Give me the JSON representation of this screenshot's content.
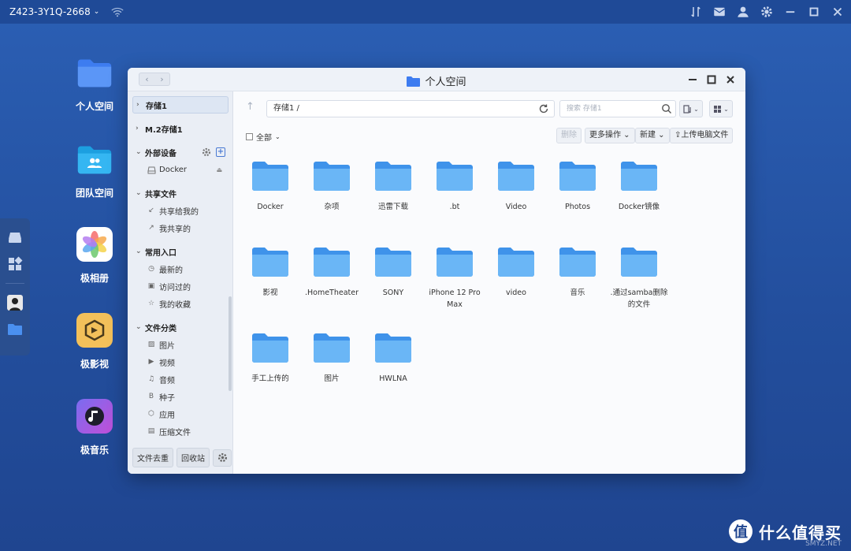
{
  "topbar": {
    "device_name": "Z423-3Y1Q-2668",
    "icons": [
      "sort-icon",
      "mail-icon",
      "user-icon",
      "gear-icon",
      "minimize-icon",
      "maximize-icon",
      "close-icon"
    ]
  },
  "desktop": {
    "icons": [
      {
        "label": "个人空间",
        "icon": "folder-icon"
      },
      {
        "label": "团队空间",
        "icon": "team-folder-icon"
      },
      {
        "label": "极相册",
        "icon": "photos-icon"
      },
      {
        "label": "极影视",
        "icon": "video-icon"
      },
      {
        "label": "极音乐",
        "icon": "music-icon"
      }
    ]
  },
  "window": {
    "title": "个人空间",
    "sidebar": {
      "storage1": "存储1",
      "m2storage": "M.2存储1",
      "external": "外部设备",
      "external_items": [
        "Docker"
      ],
      "shared": "共享文件",
      "shared_items": [
        "共享给我的",
        "我共享的"
      ],
      "common": "常用入口",
      "common_items": [
        "最新的",
        "访问过的",
        "我的收藏"
      ],
      "categories": "文件分类",
      "category_items": [
        "图片",
        "视频",
        "音频",
        "种子",
        "应用",
        "压缩文件"
      ],
      "bottom_dedupe": "文件去重",
      "bottom_recycle": "回收站"
    },
    "path": "存储1 /",
    "search_placeholder": "搜索 存储1",
    "toolbar": {
      "select_all": "全部",
      "delete": "删除",
      "more": "更多操作",
      "new": "新建",
      "upload": "上传电脑文件"
    },
    "files": [
      "Docker",
      "杂项",
      "迅雷下载",
      ".bt",
      "Video",
      "Photos",
      "Docker镜像",
      "影视",
      ".HomeTheater",
      "SONY",
      "iPhone 12 Pro Max",
      "video",
      "音乐",
      ".通过samba删除的文件",
      "手工上传的",
      "图片",
      "HWLNA"
    ]
  },
  "watermark": {
    "badge": "值",
    "text": "什么值得买",
    "sub": "SMYZ.NET"
  },
  "colors": {
    "desktop_bg": "#2b5fb4",
    "folder_blue": "#5aa7ef",
    "accent": "#4a7ad3"
  }
}
